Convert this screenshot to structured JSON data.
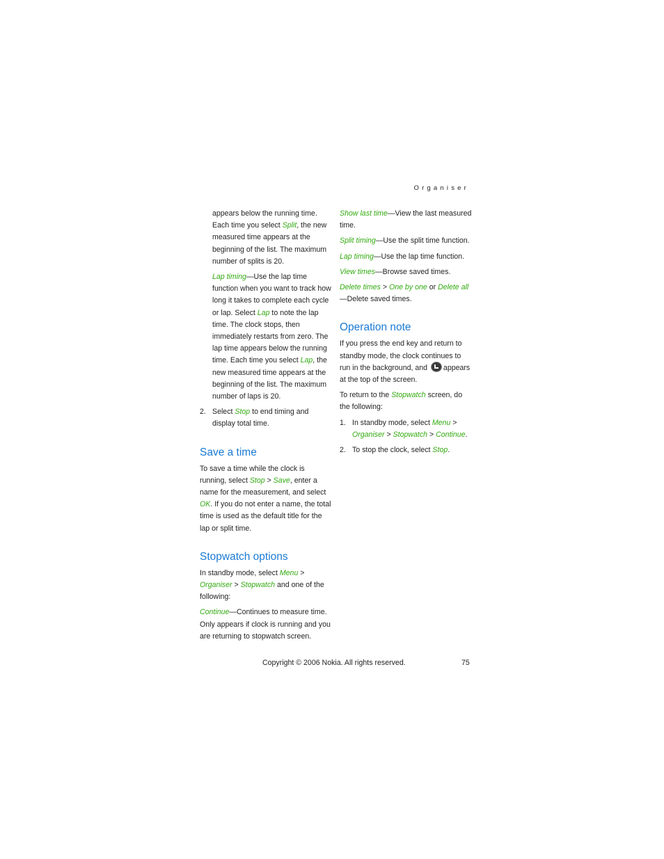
{
  "header": {
    "section": "Organiser"
  },
  "left": {
    "split_para": {
      "t1": "appears below the running time. Each time you select ",
      "k1": "Split",
      "t2": ", the new measured time appears at the beginning of the list. The maximum number of splits is 20."
    },
    "lap_para": {
      "k1": "Lap timing",
      "t1": "—Use the lap time function when you want to track how long it takes to complete each cycle or lap. Select ",
      "k2": "Lap",
      "t2": " to note the lap time. The clock stops, then immediately restarts from zero. The lap time appears below the running time. Each time you select ",
      "k3": "Lap",
      "t3": ", the new measured time appears at the beginning of the list. The maximum number of laps is 20."
    },
    "step2": {
      "num": "2.",
      "t1": "Select ",
      "k1": "Stop",
      "t2": " to end timing and display total time."
    },
    "save_heading": "Save a time",
    "save_para": {
      "t1": "To save a time while the clock is running, select ",
      "k1": "Stop",
      "t2": " > ",
      "k2": "Save",
      "t3": ", enter a name for the measurement, and select ",
      "k3": "OK",
      "t4": ". If you do not enter a name, the total time is used as the default title for the lap or split time."
    },
    "options_heading": "Stopwatch options",
    "options_para": {
      "t1": "In standby mode, select ",
      "k1": "Menu",
      "t2": " > ",
      "k2": "Organiser",
      "t3": " > ",
      "k3": "Stopwatch",
      "t4": " and one of the following:"
    },
    "continue_para": {
      "k1": "Continue",
      "t1": "—Continues to measure time. Only appears if clock is running and you are returning to stopwatch screen."
    }
  },
  "right": {
    "show_last": {
      "k1": "Show last time",
      "t1": "—View the last measured time."
    },
    "split_timing": {
      "k1": "Split timing",
      "t1": "—Use the split time function."
    },
    "lap_timing": {
      "k1": "Lap timing",
      "t1": "—Use the lap time function."
    },
    "view_times": {
      "k1": "View times",
      "t1": "—Browse saved times."
    },
    "delete_times": {
      "k1": "Delete times",
      "t1": " > ",
      "k2": "One by one",
      "t2": " or ",
      "k3": "Delete all",
      "t3": "—Delete saved times."
    },
    "op_heading": "Operation note",
    "op_para": {
      "t1": "If you press the end key and return to standby mode, the clock continues to run in the background, and ",
      "icon": "stopwatch-icon",
      "t2": " appears at the top of the screen."
    },
    "return_para": {
      "t1": "To return to the ",
      "k1": "Stopwatch",
      "t2": " screen, do the following:"
    },
    "steps": [
      {
        "num": "1.",
        "t1": "In standby mode, select ",
        "k1": "Menu",
        "t2": " > ",
        "k2": "Organiser",
        "t3": " > ",
        "k3": "Stopwatch",
        "t4": " > ",
        "k4": "Continue",
        "t5": "."
      },
      {
        "num": "2.",
        "t1": "To stop the clock, select ",
        "k1": "Stop",
        "t2": "."
      }
    ]
  },
  "footer": {
    "copyright": "Copyright © 2006 Nokia. All rights reserved.",
    "page_number": "75"
  },
  "colors": {
    "heading": "#1a7ad4",
    "keyword": "#33aa11",
    "text": "#231f20"
  }
}
